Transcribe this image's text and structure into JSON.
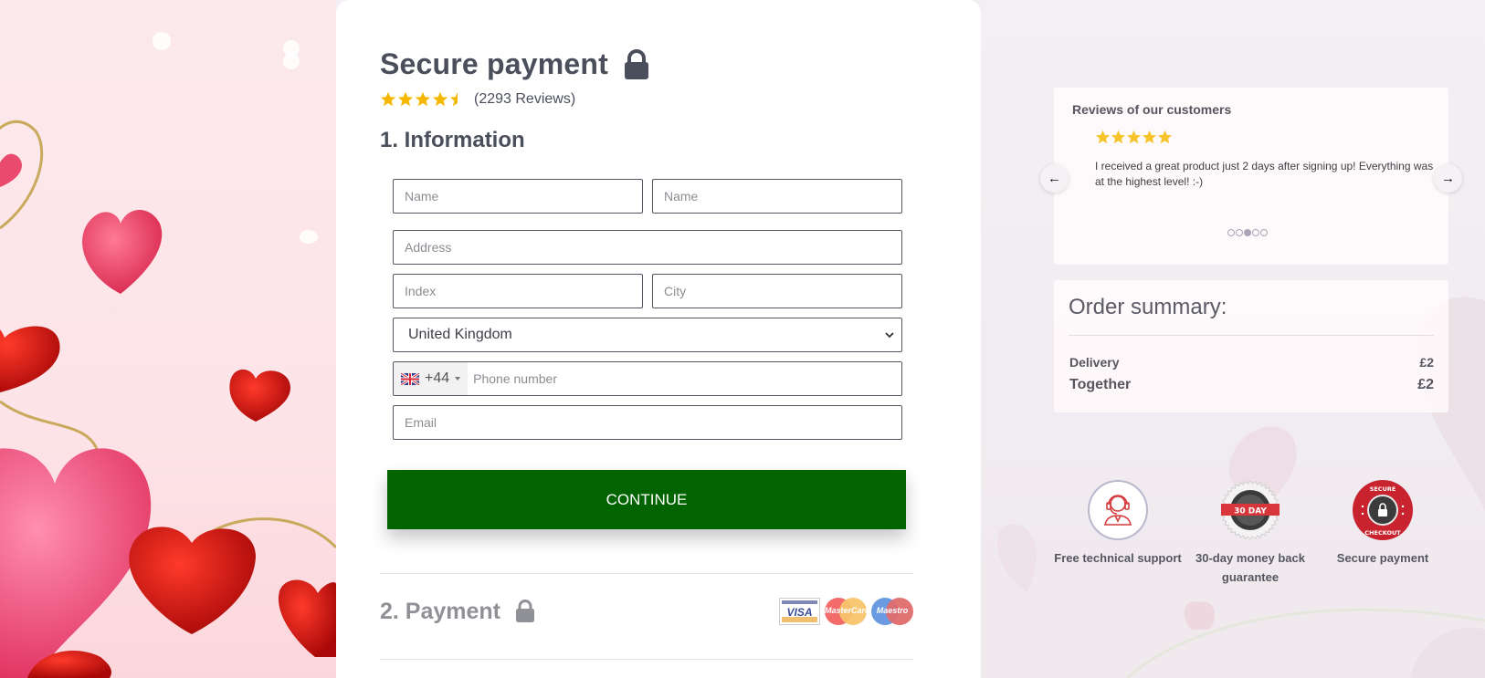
{
  "checkout": {
    "title": "Secure payment",
    "rating": 4.5,
    "rating_max": 5,
    "review_count_label": "(2293 Reviews)",
    "section_information": "1. Information",
    "fields": {
      "first_name_placeholder": "Name",
      "last_name_placeholder": "Name",
      "address_placeholder": "Address",
      "index_placeholder": "Index",
      "city_placeholder": "City",
      "country_value": "United Kingdom",
      "phone_dial_code": "+44",
      "phone_country": "United Kingdom",
      "phone_placeholder": "Phone number",
      "email_placeholder": "Email"
    },
    "continue_label": "CONTINUE",
    "section_payment": "2. Payment",
    "payment_cards": [
      {
        "name": "VISA",
        "icon": "visa-card-icon"
      },
      {
        "name": "MasterCard",
        "icon": "mastercard-icon"
      },
      {
        "name": "Maestro",
        "icon": "maestro-icon"
      }
    ]
  },
  "reviews": {
    "heading": "Reviews of our customers",
    "rating": 5,
    "text": "I received a great product just 2 days after signing up! Everything was at the highest level! :-)",
    "prev_label": "←",
    "next_label": "→",
    "slide_count": 5,
    "active_slide": 3
  },
  "summary": {
    "title": "Order summary:",
    "delivery_label": "Delivery",
    "delivery_value": "£2",
    "total_label": "Together",
    "total_value": "£2"
  },
  "badges": [
    {
      "label": "Free technical support",
      "icon": "support-agent-icon"
    },
    {
      "label": "30-day money back guarantee",
      "icon": "money-back-badge-icon",
      "badge_text": "30 DAY"
    },
    {
      "label": "Secure payment",
      "icon": "secure-checkout-badge-icon",
      "badge_text_top": "SECURE",
      "badge_text_bottom": "CHECKOUT"
    }
  ],
  "colors": {
    "primary_button": "#016400",
    "star": "#f5b800",
    "heading": "#4b4f5c"
  }
}
